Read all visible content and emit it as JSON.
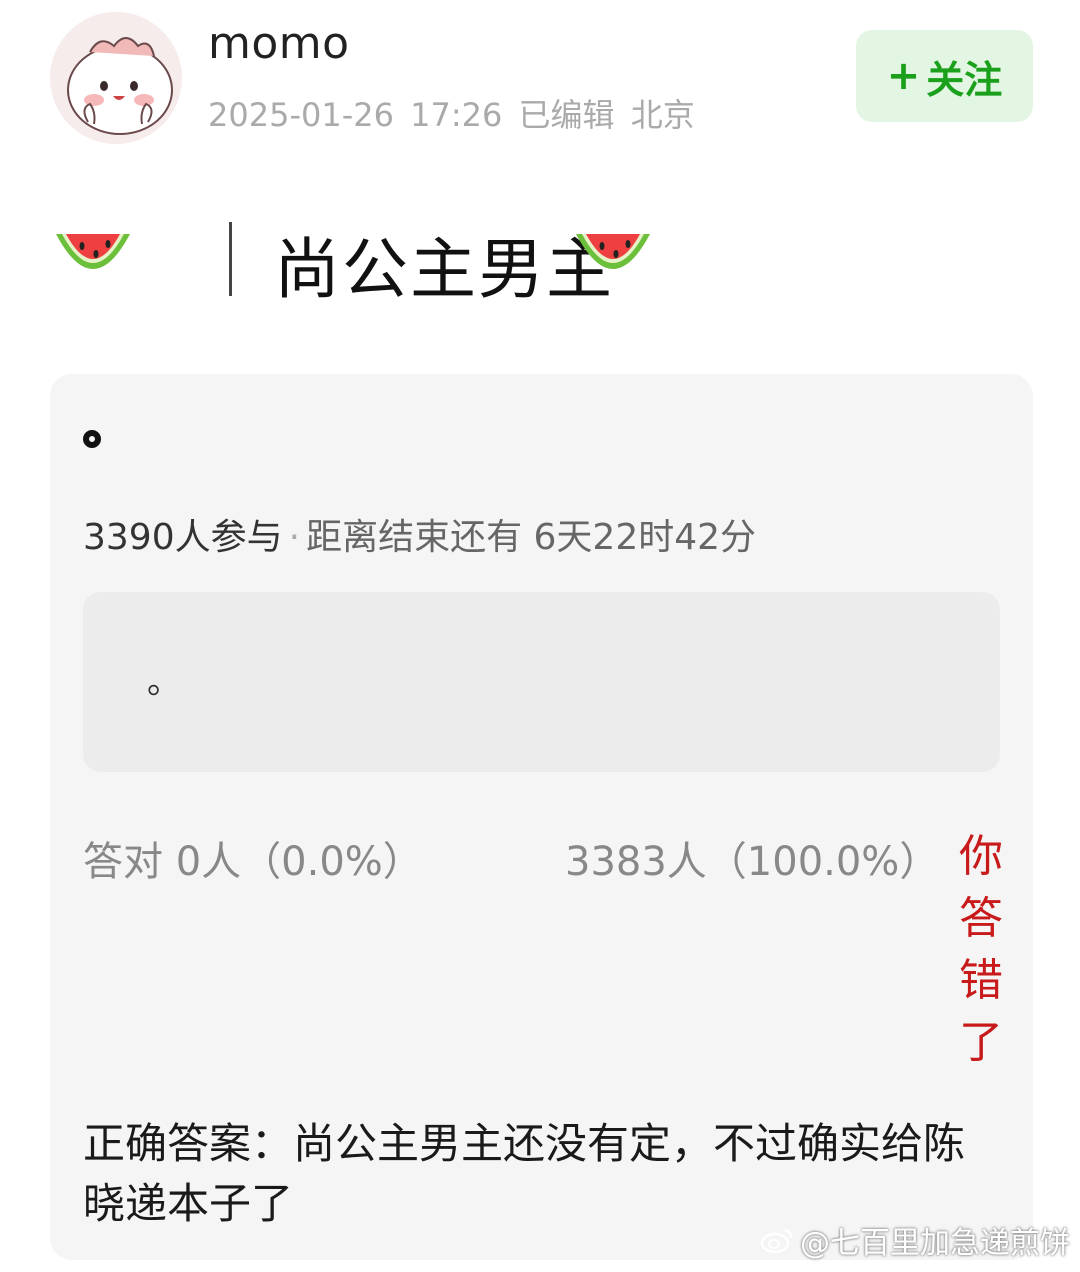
{
  "header": {
    "username": "momo",
    "date": "2025-01-26 17:26",
    "edited": "已编辑",
    "location": "北京",
    "follow_label": "关注",
    "follow_plus": "+"
  },
  "post": {
    "title": "尚公主男主",
    "title_separator": "|"
  },
  "poll": {
    "question": "。",
    "participants": "3390人参与",
    "countdown": "距离结束还有 6天22时42分",
    "option_text": "。",
    "correct_label": "答对",
    "correct_count": "0人（0.0%）",
    "option_count": "3383人（100.0%）",
    "wrong_text": "你答错了",
    "answer_text": "正确答案：尚公主男主还没有定，不过确实给陈晓递本子了"
  },
  "watermark": {
    "text": "@七百里加急递煎饼"
  },
  "colors": {
    "follow_green": "#1aa01a",
    "follow_bg": "#e3f5e3",
    "wrong_red": "#c81a1a"
  },
  "icons": {
    "avatar": "cartoon-bunny-avatar",
    "title_icon_left": "watermelon-icon",
    "title_icon_right": "watermelon-icon",
    "watermark_icon": "weibo-icon"
  }
}
